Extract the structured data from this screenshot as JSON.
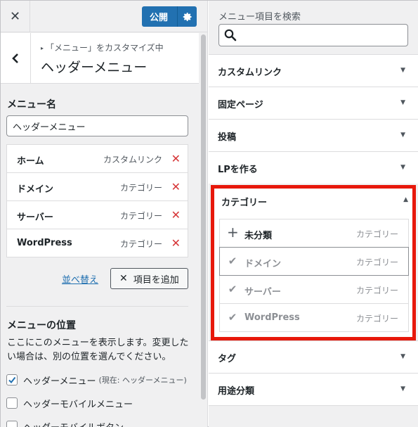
{
  "topbar": {
    "close_label": "✕",
    "publish_label": "公開",
    "publish_colors": {
      "bg": "#2271b1"
    }
  },
  "section": {
    "breadcrumb": "「メニュー」をカスタマイズ中",
    "title": "ヘッダーメニュー"
  },
  "menu_name": {
    "label": "メニュー名",
    "value": "ヘッダーメニュー"
  },
  "menu_items": [
    {
      "title": "ホーム",
      "type": "カスタムリンク"
    },
    {
      "title": "ドメイン",
      "type": "カテゴリー"
    },
    {
      "title": "サーバー",
      "type": "カテゴリー"
    },
    {
      "title": "WordPress",
      "type": "カテゴリー"
    }
  ],
  "actions": {
    "reorder_label": "並べ替え",
    "add_items_label": "項目を追加"
  },
  "location": {
    "heading": "メニューの位置",
    "description": "ここにこのメニューを表示します。変更したい場合は、別の位置を選んでください。",
    "options": [
      {
        "label": "ヘッダーメニュー",
        "note": "(現在: ヘッダーメニュー)",
        "checked": true
      },
      {
        "label": "ヘッダーモバイルメニュー",
        "note": "",
        "checked": false
      },
      {
        "label": "ヘッダーモバイルボタン",
        "note": "",
        "checked": false
      }
    ]
  },
  "search": {
    "label": "メニュー項目を検索",
    "value": ""
  },
  "panels_top": [
    {
      "title": "カスタムリンク"
    },
    {
      "title": "固定ページ"
    },
    {
      "title": "投稿"
    },
    {
      "title": "LPを作る"
    }
  ],
  "category_panel": {
    "title": "カテゴリー",
    "highlight_color": "#e7180b",
    "items": [
      {
        "name": "未分類",
        "type": "カテゴリー",
        "added": false
      },
      {
        "name": "ドメイン",
        "type": "カテゴリー",
        "added": true
      },
      {
        "name": "サーバー",
        "type": "カテゴリー",
        "added": true
      },
      {
        "name": "WordPress",
        "type": "カテゴリー",
        "added": true
      }
    ]
  },
  "panels_bottom": [
    {
      "title": "タグ"
    },
    {
      "title": "用途分類"
    }
  ]
}
